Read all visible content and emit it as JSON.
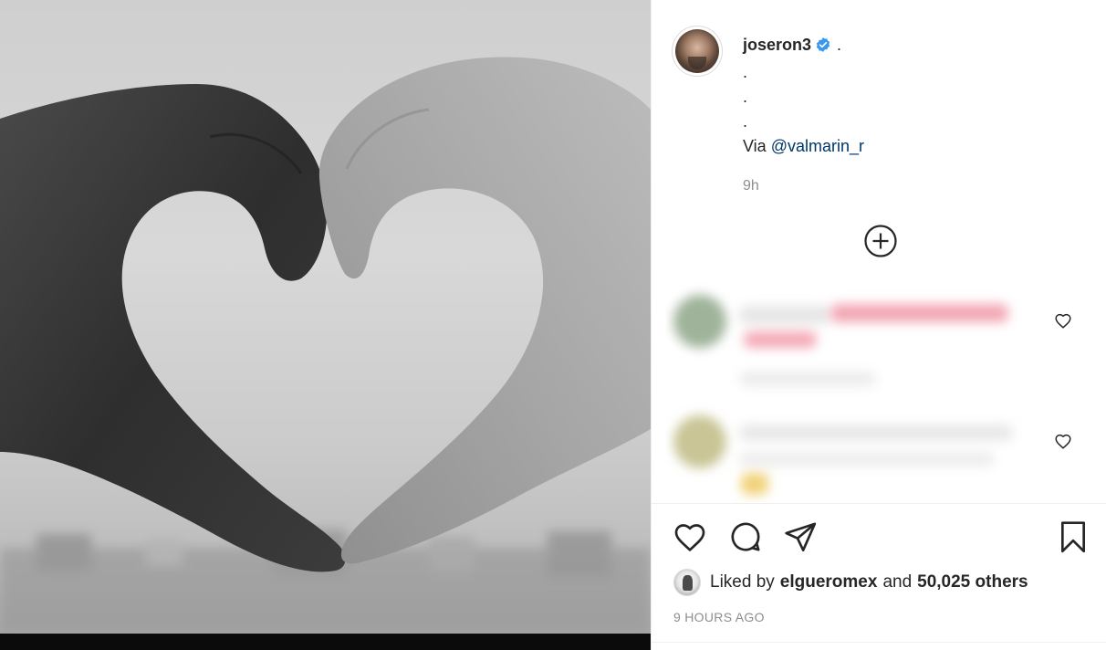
{
  "post": {
    "image_alt": "",
    "author": {
      "username": "joseron3",
      "verified": true
    },
    "caption_lines": [
      ".",
      ".",
      ".",
      "."
    ],
    "caption_via_prefix": "Via",
    "caption_mention": "@valmarin_r",
    "relative_time": "9h"
  },
  "actions": {
    "like_icon": "heart-icon",
    "comment_icon": "comment-icon",
    "share_icon": "send-icon",
    "save_icon": "bookmark-icon"
  },
  "likes": {
    "liked_by_prefix": "Liked by",
    "liked_by_user": "elgueromex",
    "and_text": "and",
    "others_count": "50,025 others"
  },
  "timestamp": "9 HOURS AGO",
  "colors": {
    "text": "#262626",
    "muted": "#8e8e8e",
    "mention": "#00376b",
    "verified": "#3897f0",
    "border": "#dbdbdb"
  }
}
